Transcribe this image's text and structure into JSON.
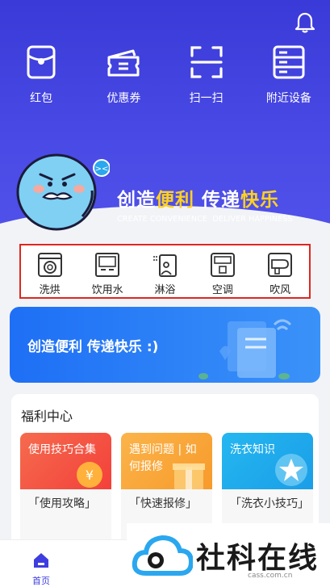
{
  "header": {
    "bell_icon": "bell-icon"
  },
  "quick_actions": [
    {
      "label": "红包",
      "icon": "red-envelope-icon"
    },
    {
      "label": "优惠券",
      "icon": "coupon-icon"
    },
    {
      "label": "扫一扫",
      "icon": "scan-icon"
    },
    {
      "label": "附近设备",
      "icon": "nearby-devices-icon"
    }
  ],
  "hero": {
    "slogan_part1": "创造",
    "slogan_part2": "便利",
    "slogan_part3": "传递",
    "slogan_part4": "快乐",
    "slogan_en_left": "CREATE CONVENIENCE",
    "slogan_en_right": "DELIVER HAPPINESS"
  },
  "appliances": [
    {
      "label": "洗烘",
      "icon": "washer-icon"
    },
    {
      "label": "饮用水",
      "icon": "water-dispenser-icon"
    },
    {
      "label": "淋浴",
      "icon": "shower-icon"
    },
    {
      "label": "空调",
      "icon": "air-conditioner-icon"
    },
    {
      "label": "吹风",
      "icon": "hair-dryer-icon"
    }
  ],
  "banner": {
    "text": "创造便利 传递快乐 :)"
  },
  "welfare": {
    "title": "福利中心",
    "cards": [
      {
        "top": "使用技巧合集",
        "sub": "「使用攻略」"
      },
      {
        "top": "遇到问题 | 如何报修",
        "sub": "「快速报修」"
      },
      {
        "top": "洗衣知识",
        "sub": "「洗衣小技巧」"
      }
    ]
  },
  "tabbar": {
    "home_label": "首页"
  },
  "watermark": {
    "text": "社科在线",
    "domain": "cass.com.cn"
  },
  "colors": {
    "primary": "#3d3de0",
    "banner": "#2f84f7",
    "accent_yellow": "#ffd21f",
    "highlight_border": "#e0261f"
  }
}
